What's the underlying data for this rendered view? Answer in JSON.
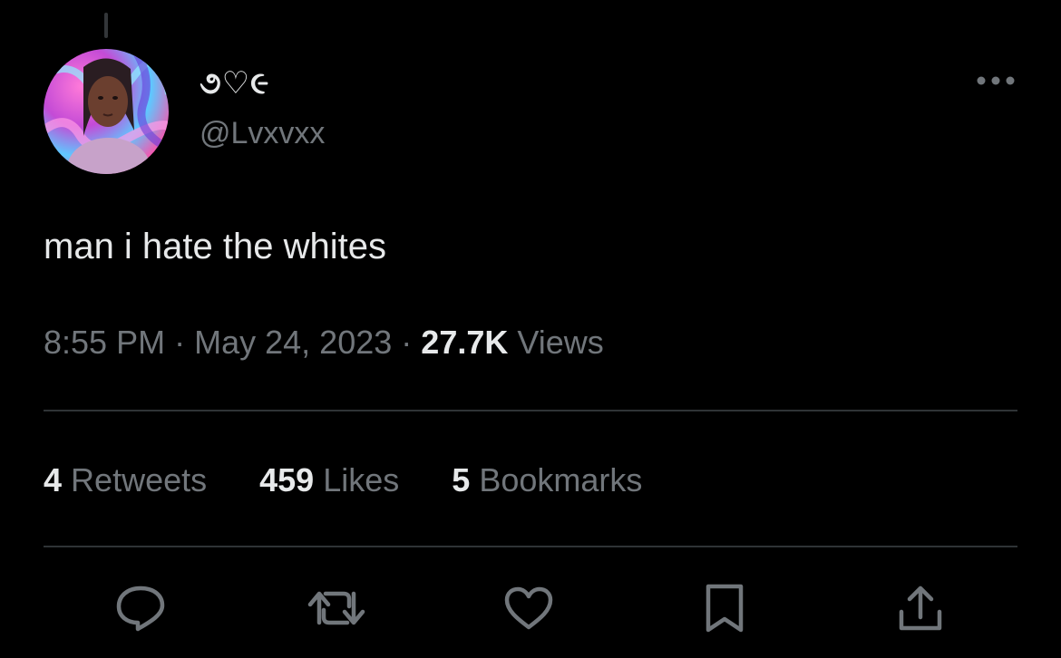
{
  "tweet": {
    "author": {
      "display_name": "૭♡૯",
      "handle": "@Lvxvxx",
      "avatar": "avatar-photo"
    },
    "text": "man i hate the whites",
    "time": "8:55 PM",
    "date": "May 24, 2023",
    "separator": "·",
    "views_count": "27.7K",
    "views_label": "Views"
  },
  "stats": {
    "retweets_count": "4",
    "retweets_label": "Retweets",
    "likes_count": "459",
    "likes_label": "Likes",
    "bookmarks_count": "5",
    "bookmarks_label": "Bookmarks"
  },
  "actions": [
    {
      "icon": "reply-icon"
    },
    {
      "icon": "retweet-icon"
    },
    {
      "icon": "like-icon"
    },
    {
      "icon": "bookmark-icon"
    },
    {
      "icon": "share-icon"
    }
  ],
  "colors": {
    "background": "#000000",
    "primary_text": "#e7e9ea",
    "secondary_text": "#71767b",
    "divider": "#2f3336"
  }
}
